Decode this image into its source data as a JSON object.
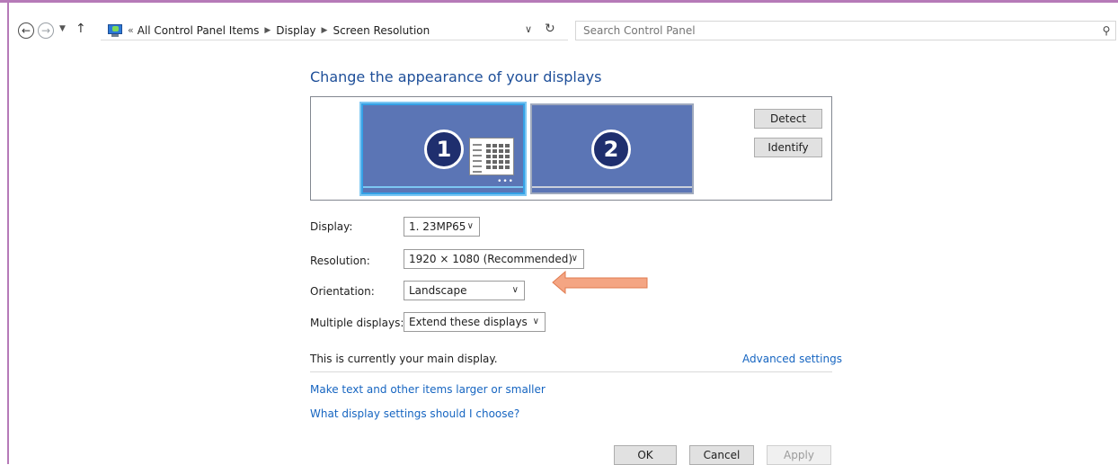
{
  "address_bar": {
    "breadcrumbs": [
      "All Control Panel Items",
      "Display",
      "Screen Resolution"
    ],
    "search_placeholder": "Search Control Panel"
  },
  "main": {
    "title": "Change the appearance of your displays",
    "monitors": [
      {
        "number": "1",
        "selected": true
      },
      {
        "number": "2",
        "selected": false
      }
    ],
    "detect_label": "Detect",
    "identify_label": "Identify",
    "fields": {
      "display": {
        "label": "Display:",
        "value": "1. 23MP65"
      },
      "resolution": {
        "label": "Resolution:",
        "value": "1920 × 1080 (Recommended)"
      },
      "orientation": {
        "label": "Orientation:",
        "value": "Landscape"
      },
      "multiple_displays": {
        "label": "Multiple displays:",
        "value": "Extend these displays"
      }
    },
    "main_display_text": "This is currently your main display.",
    "advanced_settings_link": "Advanced settings",
    "links": {
      "text_size": "Make text and other items larger or smaller",
      "help": "What display settings should I choose?"
    }
  },
  "dialog_buttons": {
    "ok": "OK",
    "cancel": "Cancel",
    "apply": "Apply"
  },
  "colors": {
    "title": "#1e4f99",
    "link": "#1665c1",
    "monitor_fill": "#5b75b5",
    "selected_border": "#35a1e6",
    "annotation_arrow": "#f4a583",
    "window_frame": "#b67ab8"
  },
  "icons": {
    "back": "back-arrow-icon",
    "forward": "forward-arrow-icon",
    "up": "up-arrow-icon",
    "refresh": "refresh-icon",
    "search": "search-icon",
    "control_panel": "control-panel-icon"
  }
}
